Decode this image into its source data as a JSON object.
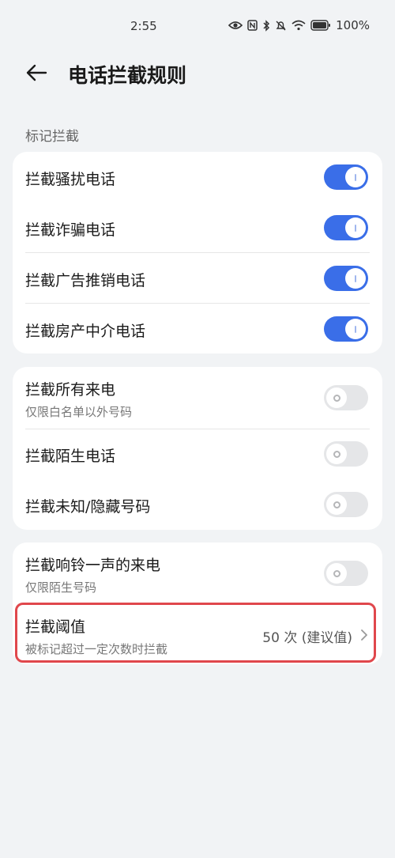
{
  "status_bar": {
    "time": "2:55",
    "battery_percent": "100%",
    "icons": [
      "eye-icon",
      "nfc-icon",
      "bluetooth-icon",
      "mute-icon",
      "wifi-icon",
      "battery-icon"
    ]
  },
  "header": {
    "title": "电话拦截规则",
    "back_icon": "arrow-left-icon"
  },
  "sections": {
    "mark_label": "标记拦截"
  },
  "card1": {
    "items": [
      {
        "label": "拦截骚扰电话",
        "toggle_on": true
      },
      {
        "label": "拦截诈骗电话",
        "toggle_on": true
      },
      {
        "label": "拦截广告推销电话",
        "toggle_on": true
      },
      {
        "label": "拦截房产中介电话",
        "toggle_on": true
      }
    ]
  },
  "card2": {
    "items": [
      {
        "label": "拦截所有来电",
        "sublabel": "仅限白名单以外号码",
        "toggle_on": false
      },
      {
        "label": "拦截陌生电话",
        "toggle_on": false
      },
      {
        "label": "拦截未知/隐藏号码",
        "toggle_on": false
      }
    ]
  },
  "card3": {
    "ring_once": {
      "label": "拦截响铃一声的来电",
      "sublabel": "仅限陌生号码",
      "toggle_on": false
    },
    "threshold": {
      "label": "拦截阈值",
      "sublabel": "被标记超过一定次数时拦截",
      "value": "50 次 (建议值)"
    }
  },
  "colors": {
    "accent": "#3a6ee8",
    "highlight": "#e0474c",
    "background": "#f1f3f5"
  }
}
